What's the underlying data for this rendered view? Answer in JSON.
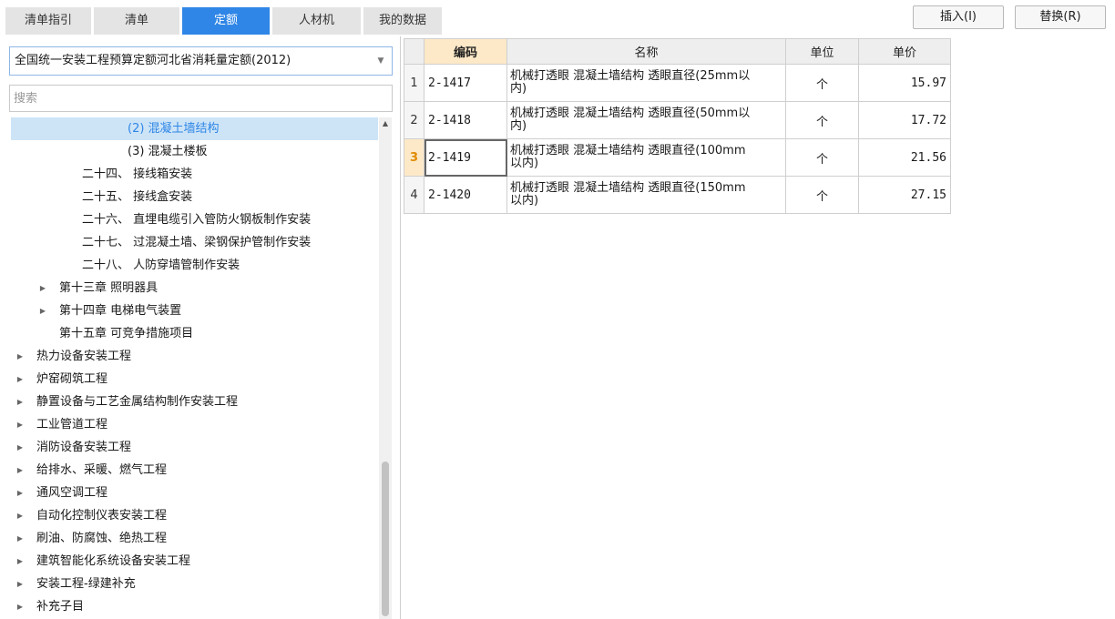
{
  "tabs": [
    "清单指引",
    "清单",
    "定额",
    "人材机",
    "我的数据"
  ],
  "active_tab": "定额",
  "buttons": {
    "insert": "插入(I)",
    "replace": "替换(R)"
  },
  "quota_library": {
    "selected": "全国统一安装工程预算定额河北省消耗量定额(2012)"
  },
  "search": {
    "placeholder": "搜索",
    "value": ""
  },
  "tree": [
    {
      "label": "(2) 混凝土墙结构",
      "selected": true
    },
    {
      "label": "(3) 混凝土楼板"
    },
    {
      "label": "二十四、 接线箱安装"
    },
    {
      "label": "二十五、 接线盒安装"
    },
    {
      "label": "二十六、 直埋电缆引入管防火钢板制作安装"
    },
    {
      "label": "二十七、 过混凝土墙、梁钢保护管制作安装"
    },
    {
      "label": "二十八、 人防穿墙管制作安装"
    },
    {
      "label": "第十三章 照明器具",
      "expandable": true
    },
    {
      "label": "第十四章 电梯电气装置",
      "expandable": true
    },
    {
      "label": "第十五章 可竞争措施项目"
    },
    {
      "label": "热力设备安装工程",
      "expandable": true
    },
    {
      "label": "炉窑砌筑工程",
      "expandable": true
    },
    {
      "label": "静置设备与工艺金属结构制作安装工程",
      "expandable": true
    },
    {
      "label": "工业管道工程",
      "expandable": true
    },
    {
      "label": "消防设备安装工程",
      "expandable": true
    },
    {
      "label": "给排水、采暖、燃气工程",
      "expandable": true
    },
    {
      "label": "通风空调工程",
      "expandable": true
    },
    {
      "label": "自动化控制仪表安装工程",
      "expandable": true
    },
    {
      "label": "刷油、防腐蚀、绝热工程",
      "expandable": true
    },
    {
      "label": "建筑智能化系统设备安装工程",
      "expandable": true
    },
    {
      "label": "安装工程-绿建补充",
      "expandable": true
    },
    {
      "label": "补充子目",
      "expandable": true
    }
  ],
  "table": {
    "columns": [
      "编码",
      "名称",
      "单位",
      "单价"
    ],
    "current_row": 3,
    "rows": [
      {
        "idx": "1",
        "code": "2-1417",
        "name_line1": "机械打透眼 混凝土墙结构 透眼直径(25mm以",
        "name_line2": "内)",
        "unit": "个",
        "price": "15.97"
      },
      {
        "idx": "2",
        "code": "2-1418",
        "name_line1": "机械打透眼 混凝土墙结构 透眼直径(50mm以",
        "name_line2": "内)",
        "unit": "个",
        "price": "17.72"
      },
      {
        "idx": "3",
        "code": "2-1419",
        "name_line1": "机械打透眼 混凝土墙结构 透眼直径(100mm",
        "name_line2": "以内)",
        "unit": "个",
        "price": "21.56"
      },
      {
        "idx": "4",
        "code": "2-1420",
        "name_line1": "机械打透眼 混凝土墙结构 透眼直径(150mm",
        "name_line2": "以内)",
        "unit": "个",
        "price": "27.15"
      }
    ]
  },
  "colors": {
    "accent": "#2f86e6",
    "selected_row_bg": "#cde4f7",
    "header_highlight": "#fde9c8"
  }
}
